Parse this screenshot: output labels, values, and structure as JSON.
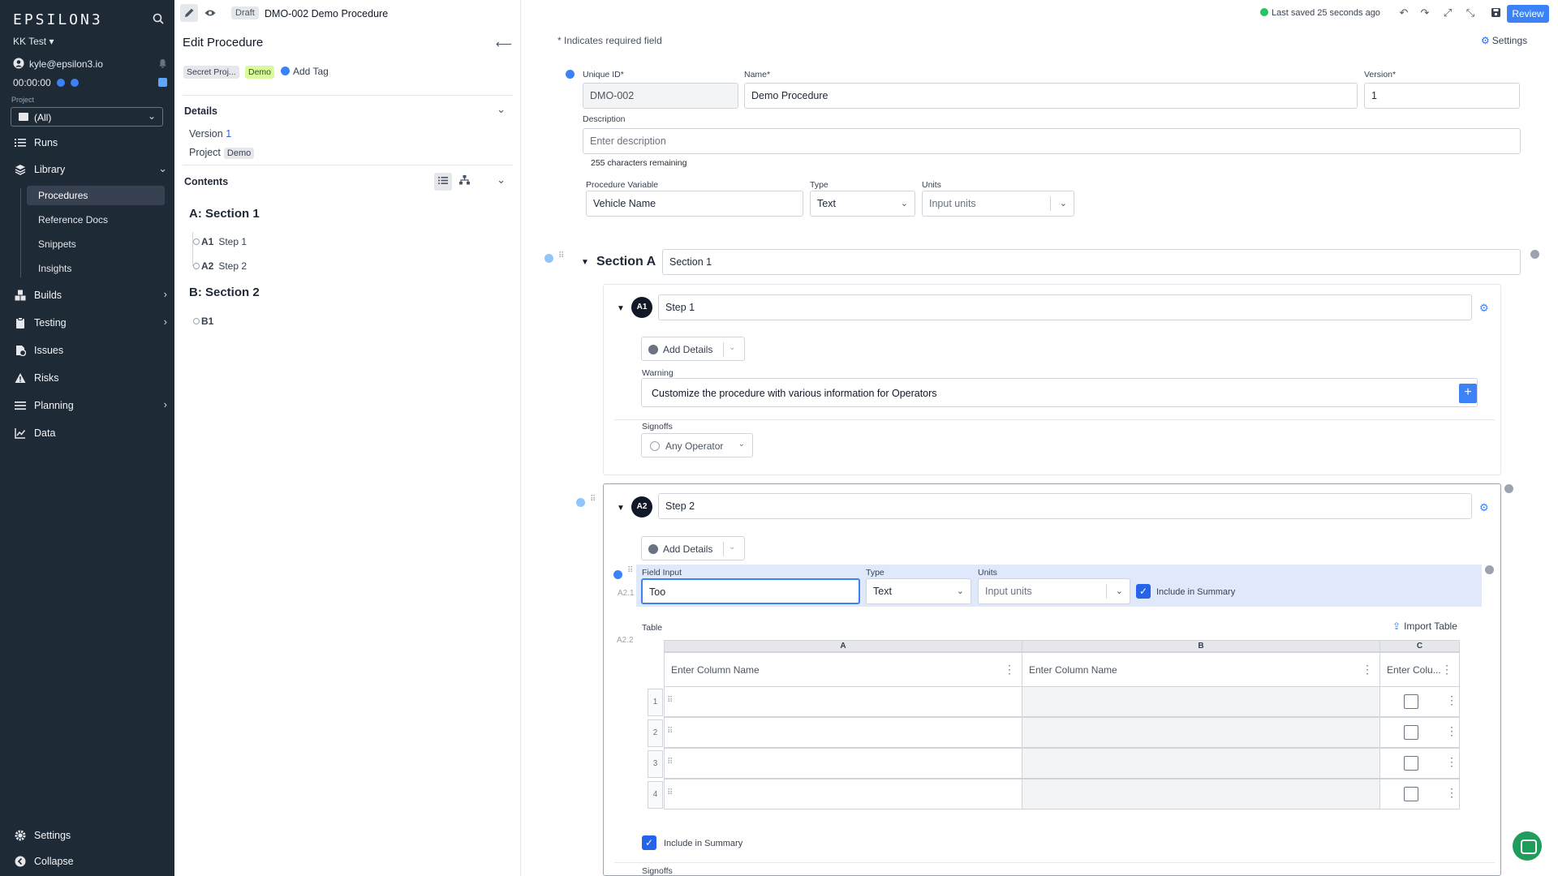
{
  "app": {
    "logo": "EPSILON3",
    "org": "KK Test ▾",
    "user_email": "kyle@epsilon3.io",
    "timer": "00:00:00",
    "project_label": "Project",
    "project_value": "(All)"
  },
  "nav": {
    "runs": "Runs",
    "library": "Library",
    "library_items": [
      "Procedures",
      "Reference Docs",
      "Snippets",
      "Insights"
    ],
    "builds": "Builds",
    "testing": "Testing",
    "issues": "Issues",
    "risks": "Risks",
    "planning": "Planning",
    "data": "Data",
    "settings": "Settings",
    "collapse": "Collapse"
  },
  "toolbar": {
    "status_badge": "Draft",
    "doc_title": "DMO-002 Demo Procedure",
    "last_saved": "Last saved 25 seconds ago",
    "review": "Review"
  },
  "panel": {
    "title": "Edit Procedure",
    "tags": [
      "Secret Proj...",
      "Demo"
    ],
    "add_tag": "Add Tag",
    "details_heading": "Details",
    "version_label": "Version",
    "version_value": "1",
    "project_label": "Project",
    "project_value": "Demo",
    "contents_heading": "Contents",
    "toc": {
      "section_a": "A: Section 1",
      "a1_id": "A1",
      "a1_name": "Step 1",
      "a2_id": "A2",
      "a2_name": "Step 2",
      "section_b": "B: Section 2",
      "b1_id": "B1"
    }
  },
  "form": {
    "required_note": "* Indicates required field",
    "settings": "Settings",
    "unique_id_label": "Unique ID*",
    "unique_id_value": "DMO-002",
    "name_label": "Name*",
    "name_value": "Demo Procedure",
    "version_label": "Version*",
    "version_value": "1",
    "description_label": "Description",
    "description_placeholder": "Enter description",
    "chars_remaining": "255 characters remaining",
    "proc_var_label": "Procedure Variable",
    "proc_var_value": "Vehicle Name",
    "type_label": "Type",
    "type_value": "Text",
    "units_label": "Units",
    "units_placeholder": "Input units"
  },
  "section_a": {
    "label": "Section A",
    "name_value": "Section 1",
    "step1": {
      "badge": "A1",
      "name_value": "Step 1",
      "add_details": "Add Details",
      "warning_label": "Warning",
      "warning_text": "Customize the procedure with various information for Operators",
      "signoffs_label": "Signoffs",
      "signoff_value": "Any Operator"
    },
    "step2": {
      "badge": "A2",
      "name_value": "Step 2",
      "add_details": "Add Details",
      "field_id": "A2.1",
      "field_label": "Field Input",
      "field_value": "Too",
      "type_label": "Type",
      "type_value": "Text",
      "units_label": "Units",
      "units_placeholder": "Input units",
      "include_summary": "Include in Summary",
      "table_id": "A2.2",
      "table_label": "Table",
      "import_table": "Import Table",
      "columns": [
        "A",
        "B",
        "C"
      ],
      "column_placeholders": [
        "Enter Column Name",
        "Enter Column Name",
        "Enter Colu..."
      ],
      "row_numbers": [
        "1",
        "2",
        "3",
        "4"
      ],
      "table_include_summary": "Include in Summary",
      "signoffs_label": "Signoffs"
    }
  },
  "colors": {
    "sidebar_bg": "#1f2a37",
    "accent": "#3b82f6",
    "tag_green": "#d9f99d",
    "saved_ok": "#22c55e"
  }
}
